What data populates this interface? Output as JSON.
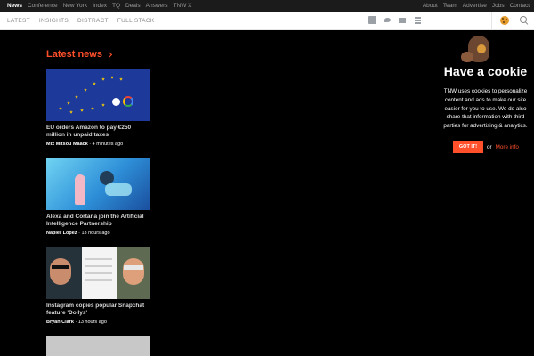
{
  "topnav": {
    "left": [
      "News",
      "Conference",
      "New York",
      "Index",
      "TQ",
      "Deals",
      "Answers",
      "TNW X"
    ],
    "right": [
      "About",
      "Team",
      "Advertise",
      "Jobs",
      "Contact"
    ]
  },
  "subnav": {
    "tabs": [
      "LATEST",
      "INSIGHTS",
      "DISTRACT",
      "FULL STACK"
    ]
  },
  "latest": {
    "heading": "Latest news"
  },
  "articles": [
    {
      "title": "EU orders Amazon to pay €250 million in unpaid taxes",
      "author": "Mix Mitsou Maack",
      "time": "· 4 minutes ago"
    },
    {
      "title": "Alexa and Cortana join the Artificial Intelligence Partnership",
      "author": "Napier Lopez",
      "time": "· 13 hours ago"
    },
    {
      "title": "Instagram copies popular Snapchat feature 'Dollys'",
      "author": "Bryan Clark",
      "time": "· 13 hours ago"
    }
  ],
  "cookie": {
    "title": "Have a cookie",
    "body": "TNW uses cookies to personalize content and ads to make our site easier for you to use. We do also share that information with third parties for advertising & analytics.",
    "button": "GOT IT!",
    "or": "or",
    "more": "More info"
  }
}
